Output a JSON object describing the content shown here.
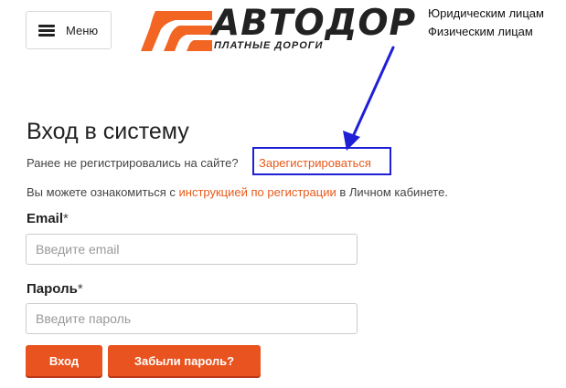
{
  "header": {
    "menu_label": "Меню",
    "logo_name": "АВТОДОР",
    "logo_tagline": "ПЛАТНЫЕ ДОРОГИ",
    "top_links": [
      "Юридическим лицам",
      "Физическим лицам"
    ]
  },
  "login": {
    "title": "Вход в систему",
    "register_prompt": "Ранее не регистрировались на сайте?",
    "register_link": "Зарегистрироваться",
    "info_prefix": "Вы можете ознакомиться с",
    "info_link": "инструкцией по регистрации",
    "info_suffix": "в Личном кабинете.",
    "email_label": "Email",
    "email_placeholder": "Введите email",
    "password_label": "Пароль",
    "password_placeholder": "Введите пароль",
    "required_mark": "*",
    "login_button": "Вход",
    "forgot_button": "Забыли пароль?"
  },
  "colors": {
    "accent": "#e8531f",
    "link": "#e85a1b",
    "annotation": "#1f1fd6"
  },
  "icons": {
    "menu": "hamburger-icon",
    "logo": "road-stripes-logo"
  }
}
